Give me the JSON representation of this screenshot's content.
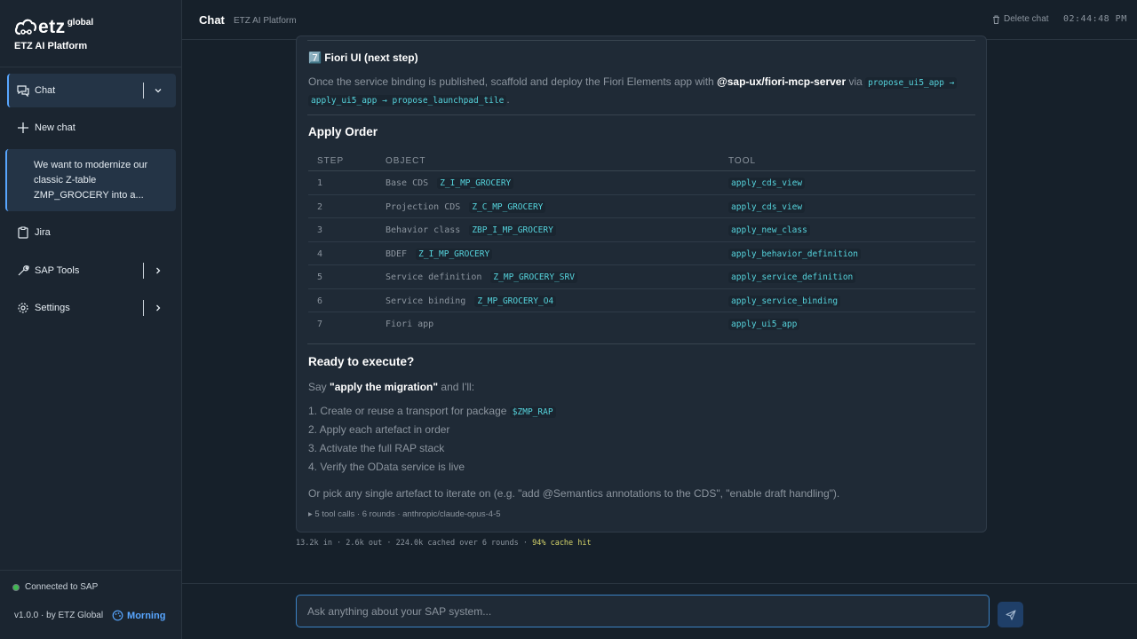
{
  "brand": {
    "logo_text": "etz",
    "logo_sup": "global",
    "platform": "ETZ AI Platform"
  },
  "sidebar": {
    "chat_label": "Chat",
    "new_chat_label": "New chat",
    "recent_chat": "We want to modernize our classic Z-table ZMP_GROCERY into a...",
    "jira_label": "Jira",
    "sap_tools_label": "SAP Tools",
    "settings_label": "Settings",
    "status": "Connected to SAP",
    "version": "v1.0.0 · by ETZ Global",
    "theme_label": "Morning"
  },
  "header": {
    "title": "Chat",
    "subtitle": "ETZ AI Platform",
    "delete_label": "Delete chat",
    "clock": "02:44:48 PM"
  },
  "message": {
    "fiori_heading": "7️⃣ Fiori UI (next step)",
    "fiori_text_1": "Once the service binding is published, scaffold and deploy the Fiori Elements app with ",
    "fiori_server": "@sap-ux/fiori-mcp-server",
    "fiori_text_2": " via ",
    "fiori_code_1": "propose_ui5_app →",
    "fiori_code_2": "apply_ui5_app → propose_launchpad_tile",
    "fiori_text_3": ".",
    "apply_heading": "Apply Order",
    "table_headers": [
      "STEP",
      "OBJECT",
      "TOOL"
    ],
    "table_rows": [
      {
        "step": "1",
        "object": "Base CDS",
        "object_code": "Z_I_MP_GROCERY",
        "tool": "apply_cds_view"
      },
      {
        "step": "2",
        "object": "Projection CDS",
        "object_code": "Z_C_MP_GROCERY",
        "tool": "apply_cds_view"
      },
      {
        "step": "3",
        "object": "Behavior class",
        "object_code": "ZBP_I_MP_GROCERY",
        "tool": "apply_new_class"
      },
      {
        "step": "4",
        "object": "BDEF",
        "object_code": "Z_I_MP_GROCERY",
        "tool": "apply_behavior_definition"
      },
      {
        "step": "5",
        "object": "Service definition",
        "object_code": "Z_MP_GROCERY_SRV",
        "tool": "apply_service_definition"
      },
      {
        "step": "6",
        "object": "Service binding",
        "object_code": "Z_MP_GROCERY_O4",
        "tool": "apply_service_binding"
      },
      {
        "step": "7",
        "object": "Fiori app",
        "object_code": "",
        "tool": "apply_ui5_app"
      }
    ],
    "ready_heading": "Ready to execute?",
    "say_prefix": "Say ",
    "say_bold": "\"apply the migration\"",
    "say_suffix": " and I'll:",
    "step_1": "1. Create or reuse a transport for package ",
    "step_1_code": "$ZMP_RAP",
    "step_2": "2. Apply each artefact in order",
    "step_3": "3. Activate the full RAP stack",
    "step_4": "4. Verify the OData service is live",
    "pick_text": "Or pick any single artefact to iterate on (e.g. \"add @Semantics annotations to the CDS\", \"enable draft handling\").",
    "meta": "▸ 5 tool calls · 6 rounds · anthropic/claude-opus-4-5"
  },
  "stats": {
    "text": "13.2k in · 2.6k out · 224.0k cached over 6 rounds · ",
    "hit": "94% cache hit"
  },
  "composer": {
    "placeholder": "Ask anything about your SAP system..."
  }
}
